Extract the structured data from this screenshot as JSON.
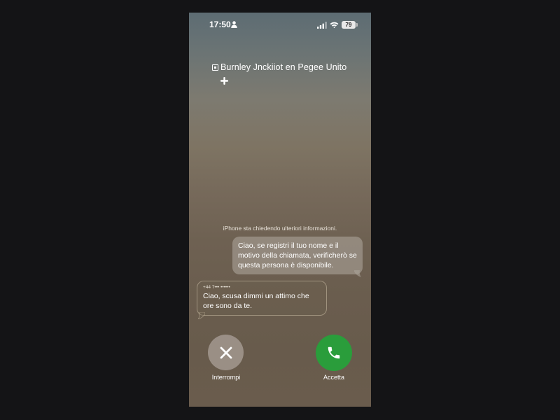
{
  "status_bar": {
    "time": "17:50",
    "battery": "79"
  },
  "caller": {
    "name": "Burnley Jnckiiot en Pegee Unito"
  },
  "screening": {
    "note": "iPhone sta chiedendo ulteriori informazioni.",
    "outgoing_message": "Ciao, se registri il tuo nome e il motivo della chiamata, verificherò se questa persona è disponibile.",
    "incoming_number": "+44 7••• ••••••",
    "incoming_message": "Ciao, scusa dimmi un attimo che ore sono da te."
  },
  "actions": {
    "decline_label": "Interrompi",
    "accept_label": "Accetta",
    "accept_color": "#2a9d3b"
  },
  "icons": {
    "person": "person-icon",
    "signal": "signal-icon",
    "wifi": "wifi-icon",
    "add": "plus-icon",
    "decline": "close-icon",
    "accept": "phone-icon"
  }
}
